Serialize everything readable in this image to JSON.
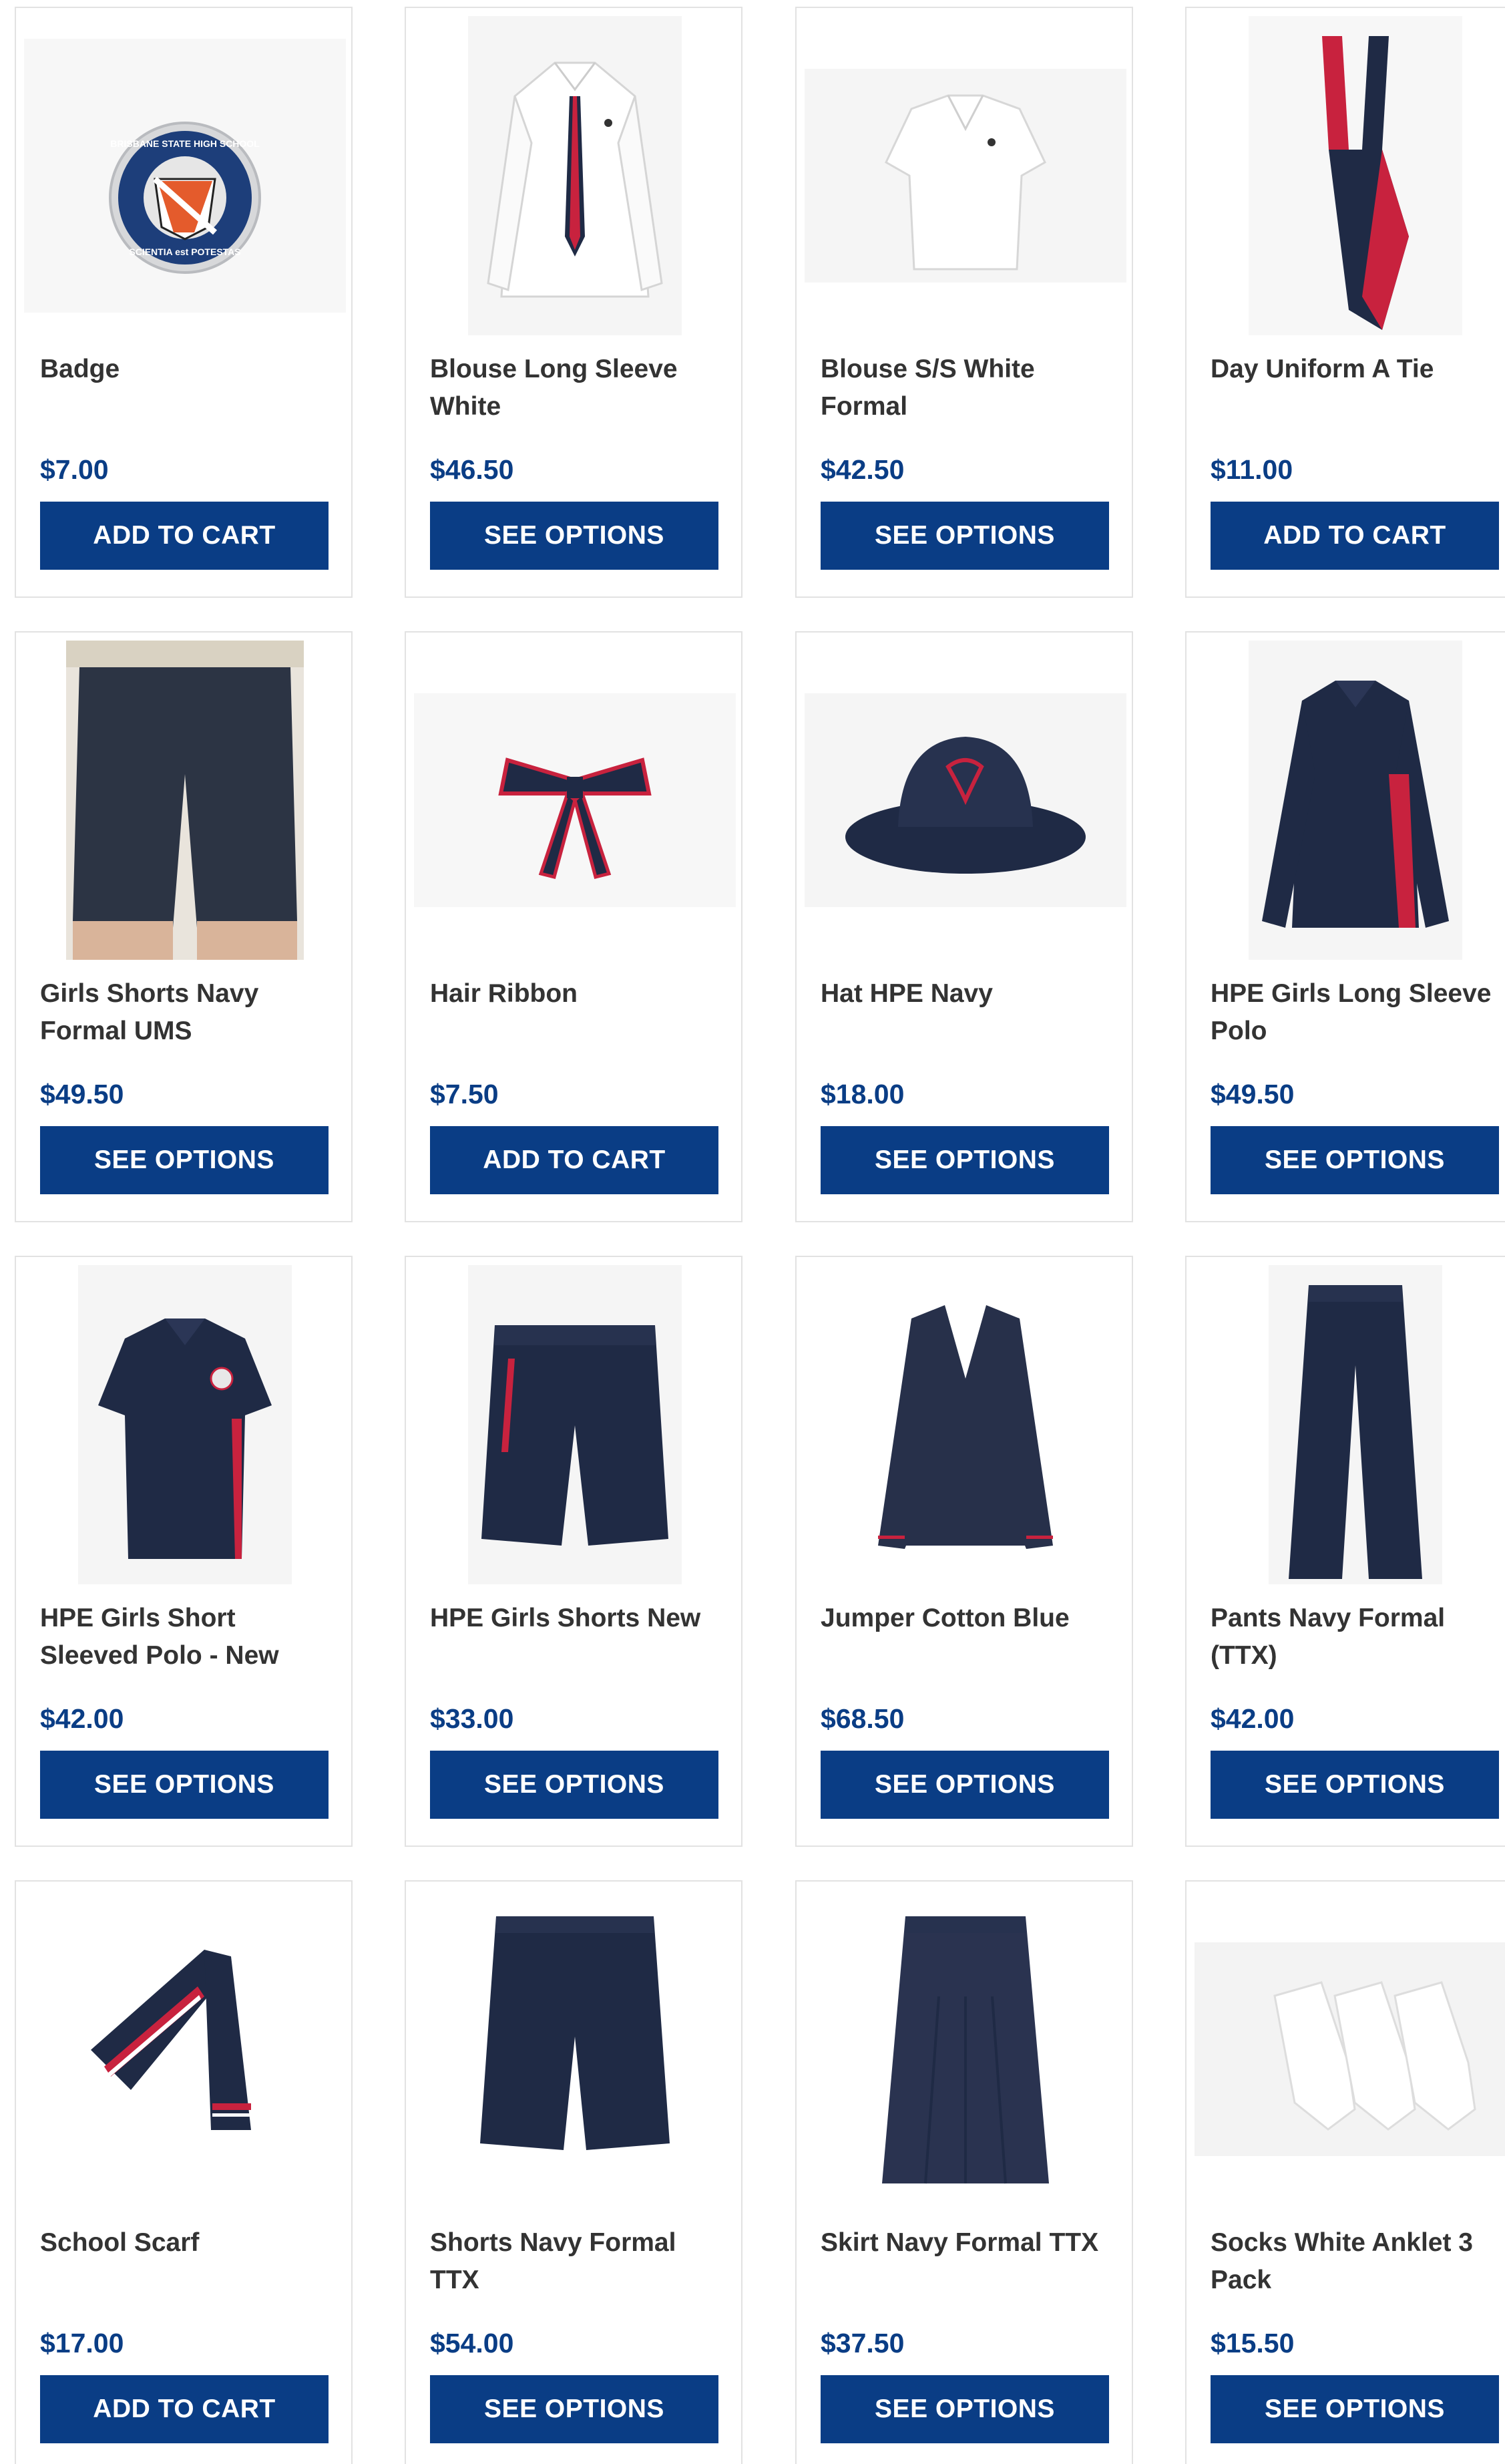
{
  "colors": {
    "price": "#0a3d85",
    "button_bg": "#0a3d85",
    "button_text": "#ffffff",
    "navy_garment": "#1f2a45",
    "accent_red": "#c8223e"
  },
  "products": [
    {
      "name": "Badge",
      "price": "$7.00",
      "button": "ADD TO CART",
      "icon": "badge-image"
    },
    {
      "name": "Blouse Long Sleeve White",
      "price": "$46.50",
      "button": "SEE OPTIONS",
      "icon": "blouse-long-sleeve-image"
    },
    {
      "name": "Blouse S/S White Formal",
      "price": "$42.50",
      "button": "SEE OPTIONS",
      "icon": "blouse-short-sleeve-image"
    },
    {
      "name": "Day Uniform A Tie",
      "price": "$11.00",
      "button": "ADD TO CART",
      "icon": "tie-image"
    },
    {
      "name": "Girls Shorts Navy Formal UMS",
      "price": "$49.50",
      "button": "SEE OPTIONS",
      "icon": "shorts-image"
    },
    {
      "name": "Hair Ribbon",
      "price": "$7.50",
      "button": "ADD TO CART",
      "icon": "ribbon-image"
    },
    {
      "name": "Hat HPE Navy",
      "price": "$18.00",
      "button": "SEE OPTIONS",
      "icon": "hat-image"
    },
    {
      "name": "HPE Girls Long Sleeve Polo",
      "price": "$49.50",
      "button": "SEE OPTIONS",
      "icon": "polo-long-image"
    },
    {
      "name": "HPE Girls Short Sleeved Polo - New",
      "price": "$42.00",
      "button": "SEE OPTIONS",
      "icon": "polo-short-image"
    },
    {
      "name": "HPE Girls Shorts New",
      "price": "$33.00",
      "button": "SEE OPTIONS",
      "icon": "sport-shorts-image"
    },
    {
      "name": "Jumper Cotton Blue",
      "price": "$68.50",
      "button": "SEE OPTIONS",
      "icon": "jumper-image"
    },
    {
      "name": "Pants Navy Formal (TTX)",
      "price": "$42.00",
      "button": "SEE OPTIONS",
      "icon": "pants-image"
    },
    {
      "name": "School Scarf",
      "price": "$17.00",
      "button": "ADD TO CART",
      "icon": "scarf-image"
    },
    {
      "name": "Shorts Navy Formal TTX",
      "price": "$54.00",
      "button": "SEE OPTIONS",
      "icon": "formal-shorts-image"
    },
    {
      "name": "Skirt Navy Formal TTX",
      "price": "$37.50",
      "button": "SEE OPTIONS",
      "icon": "skirt-image"
    },
    {
      "name": "Socks White Anklet 3 Pack",
      "price": "$15.50",
      "button": "SEE OPTIONS",
      "icon": "socks-image"
    }
  ],
  "badge_text": {
    "top": "BRISBANE STATE HIGH SCHOOL",
    "bottom": "SCIENTIA est POTESTAS"
  }
}
